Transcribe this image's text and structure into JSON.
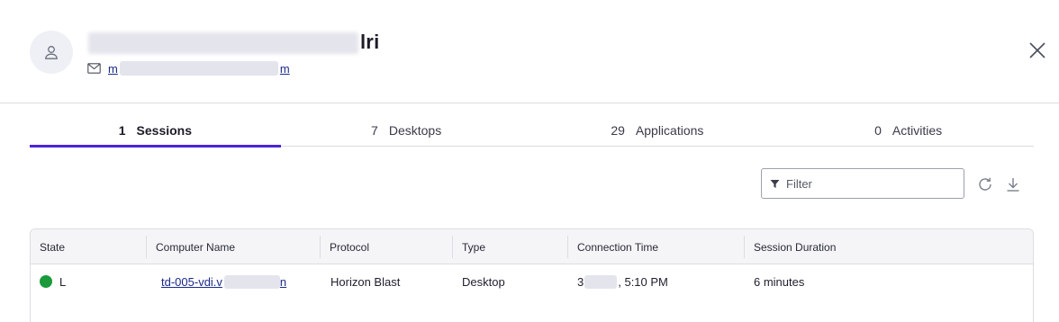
{
  "user": {
    "name_suffix": "lri",
    "email_prefix": "m",
    "email_suffix": "m"
  },
  "tabs": [
    {
      "count": "1",
      "label": "Sessions",
      "active": true
    },
    {
      "count": "7",
      "label": "Desktops",
      "active": false
    },
    {
      "count": "29",
      "label": "Applications",
      "active": false
    },
    {
      "count": "0",
      "label": "Activities",
      "active": false
    }
  ],
  "filter": {
    "placeholder": "Filter"
  },
  "table": {
    "headers": [
      "State",
      "Computer Name",
      "Protocol",
      "Type",
      "Connection Time",
      "Session Duration"
    ],
    "rows": [
      {
        "state": "L",
        "state_color": "#1a9a3a",
        "computer_prefix": "td-005-vdi.v",
        "computer_suffix": "n",
        "protocol": "Horizon Blast",
        "type": "Desktop",
        "time_prefix": "3",
        "time_suffix": ", 5:10 PM",
        "duration": "6 minutes"
      }
    ]
  },
  "icons": {
    "avatar": "user-icon",
    "email": "mail-icon",
    "close": "close-icon",
    "filter": "filter-icon",
    "refresh": "refresh-icon",
    "download": "download-icon"
  }
}
